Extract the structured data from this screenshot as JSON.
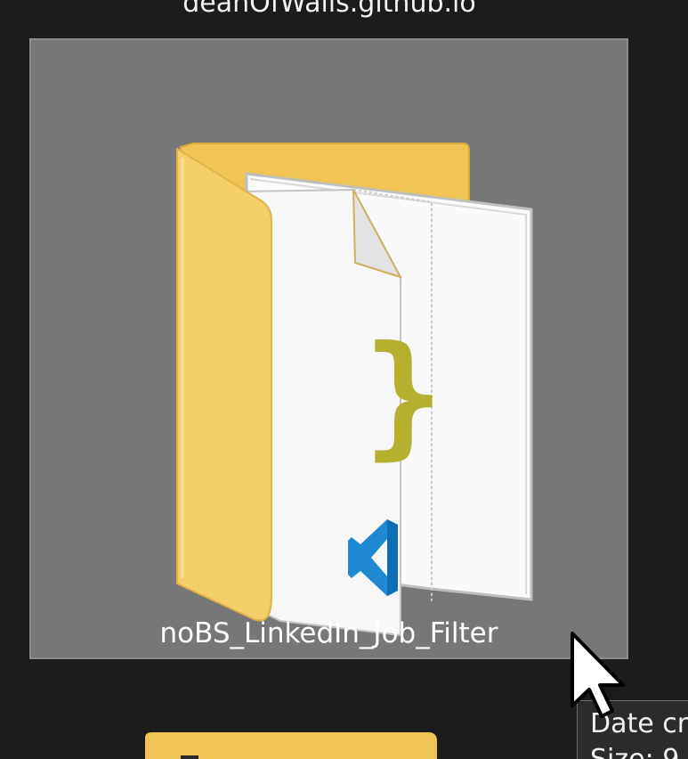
{
  "above_item": {
    "label": "deanOfWalls.github.io"
  },
  "selected_item": {
    "label": "noBS_LinkedIn_Job_Filter",
    "icon": "vscode-folder-icon",
    "state": "selected"
  },
  "below_item": {
    "icon": "folder-icon"
  },
  "tooltip": {
    "line1": "Date cr",
    "line2": "Size: 9"
  },
  "colors": {
    "background": "#1c1c1c",
    "selection": "#777777",
    "folder_yellow": "#f3c85d",
    "vscode_blue": "#1f8ad2",
    "json_braces": "#b5b02f"
  }
}
